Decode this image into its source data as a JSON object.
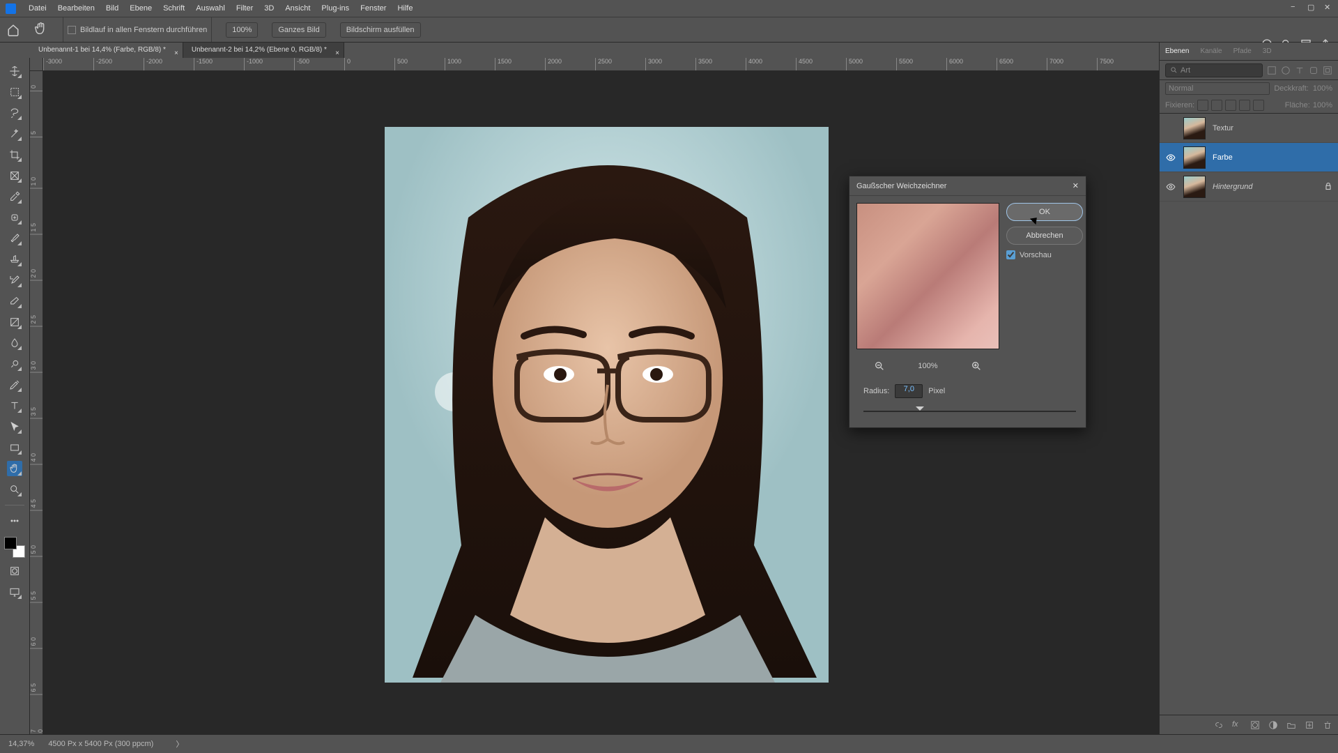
{
  "menu": {
    "items": [
      "Datei",
      "Bearbeiten",
      "Bild",
      "Ebene",
      "Schrift",
      "Auswahl",
      "Filter",
      "3D",
      "Ansicht",
      "Plug-ins",
      "Fenster",
      "Hilfe"
    ]
  },
  "options_bar": {
    "scroll_all_windows_label": "Bildlauf in allen Fenstern durchführen",
    "zoom_100": "100%",
    "ganzes_bild": "Ganzes Bild",
    "bildschirm": "Bildschirm ausfüllen"
  },
  "tabs": [
    {
      "label": "Unbenannt-1 bei 14,4% (Farbe, RGB/8) *",
      "active": true
    },
    {
      "label": "Unbenannt-2 bei 14,2% (Ebene 0, RGB/8) *",
      "active": false
    }
  ],
  "ruler_h": [
    "-3000",
    "-2500",
    "-2000",
    "-1500",
    "-1000",
    "-500",
    "0",
    "500",
    "1000",
    "1500",
    "2000",
    "2500",
    "3000",
    "3500",
    "4000",
    "4500",
    "5000",
    "5500",
    "6000",
    "6500",
    "7000",
    "7500"
  ],
  "ruler_v": [
    "0",
    "5",
    "1 0",
    "1 5",
    "2 0",
    "2 5",
    "3 0",
    "3 5",
    "4 0",
    "4 5",
    "5 0",
    "5 5",
    "6 0",
    "6 5",
    "7 0"
  ],
  "status": {
    "zoom": "14,37%",
    "info": "4500 Px x 5400 Px (300 ppcm)"
  },
  "panels": {
    "tabs": [
      "Ebenen",
      "Kanäle",
      "Pfade",
      "3D"
    ],
    "search_placeholder": "Art",
    "blend_label": "Normal",
    "opacity_label": "Deckkraft:",
    "opacity_value": "100%",
    "lock_prefix": "Fixieren:",
    "fill_label": "Fläche:",
    "fill_value": "100%"
  },
  "layers": [
    {
      "name": "Textur",
      "visible": false,
      "selected": false,
      "locked": false,
      "italic": false
    },
    {
      "name": "Farbe",
      "visible": true,
      "selected": true,
      "locked": false,
      "italic": false
    },
    {
      "name": "Hintergrund",
      "visible": true,
      "selected": false,
      "locked": true,
      "italic": true
    }
  ],
  "dialog": {
    "title": "Gaußscher Weichzeichner",
    "ok": "OK",
    "cancel": "Abbrechen",
    "preview": "Vorschau",
    "zoom": "100%",
    "radius_label": "Radius:",
    "radius_value": "7,0",
    "unit": "Pixel",
    "slider_percent": 25
  }
}
